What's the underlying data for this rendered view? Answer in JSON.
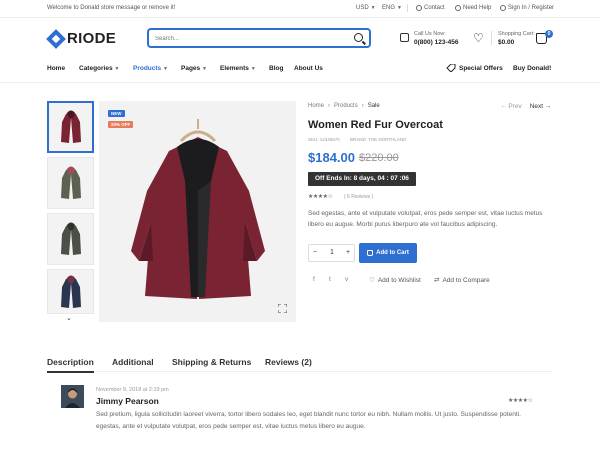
{
  "topbar": {
    "welcome": "Welcome to Donald store message or remove it!",
    "currency": "USD",
    "language": "ENG",
    "contact": "Contact",
    "help": "Need Help",
    "signin": "Sign In / Register"
  },
  "header": {
    "logo": "RIODE",
    "search_placeholder": "Search...",
    "call_label": "Call Us Now:",
    "call_number": "0(800) 123-456",
    "cart_label": "Shopping Cart:",
    "cart_total": "$0.00",
    "cart_count": "0"
  },
  "nav": {
    "items": [
      "Home",
      "Categories",
      "Products",
      "Pages",
      "Elements",
      "Blog",
      "About Us"
    ],
    "special_offers": "Special Offers",
    "buy": "Buy Donald!"
  },
  "gallery": {
    "badge_new": "NEW",
    "badge_sale": "20% OFF"
  },
  "product": {
    "breadcrumb": [
      "Home",
      "Products",
      "Sale"
    ],
    "prev": "Prev",
    "next": "Next",
    "title": "Women Red Fur Overcoat",
    "sku": "SKU: 12345670",
    "brand": "BRAND: THE NORTHLAND",
    "price": "$184.00",
    "old_price": "$220.00",
    "timer": "Off Ends In:  8 days, 04 : 07 :06",
    "rating_count": "( 6 Reviews )",
    "description": "Sed egestas, ante et vulputate volutpat, eros pede semper est, vitae luctus metus libero eu augue. Morbi purus liberpuro ate vol faucibus adipiscing.",
    "qty": "1",
    "qty_minus": "−",
    "qty_plus": "+",
    "add_to_cart": "Add to Cart",
    "wishlist": "Add to Wishlist",
    "compare": "Add to Compare",
    "social": [
      "f",
      "t",
      "v"
    ]
  },
  "tabs": [
    "Description",
    "Additional",
    "Shipping & Returns",
    "Reviews (2)"
  ],
  "review": {
    "date": "November 9, 2018 at 2:19 pm",
    "name": "Jimmy Pearson",
    "text": "Sed pretium, ligula sollicitudin laoreet viverra, tortor libero sodales leo, eget blandit nunc tortor eu nibh. Nullam mollis. Ut justo. Suspendisse potenti. egestas, ante et vulputate volutpat, eros pede semper est, vitae luctus metus libero eu augue."
  },
  "colors": {
    "accent": "#2e6fd1",
    "coat": "#7a2433"
  }
}
